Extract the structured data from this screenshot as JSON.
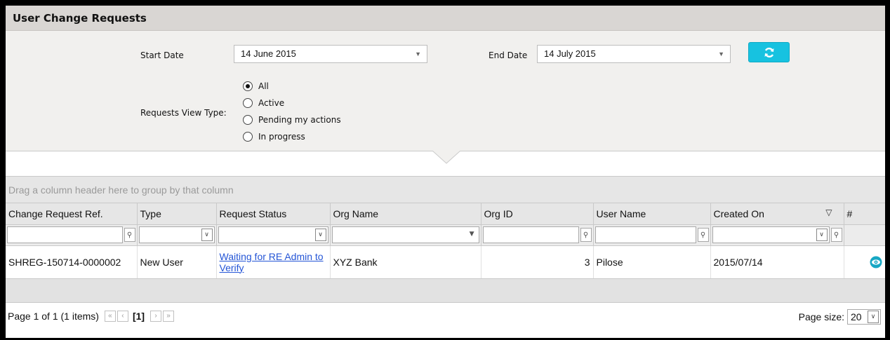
{
  "panel": {
    "title": "User Change Requests"
  },
  "filters": {
    "start_date_label": "Start Date",
    "start_date_value": "14 June 2015",
    "end_date_label": "End Date",
    "end_date_value": "14 July 2015",
    "view_type_label": "Requests View Type:",
    "view_type_options": [
      "All",
      "Active",
      "Pending my actions",
      "In progress"
    ],
    "view_type_selected": "All"
  },
  "grid": {
    "group_hint": "Drag a column header here to group by that column",
    "columns": [
      "Change Request Ref.",
      "Type",
      "Request Status",
      "Org Name",
      "Org ID",
      "User Name",
      "Created On",
      "#"
    ],
    "rows": [
      {
        "ref": "SHREG-150714-0000002",
        "type": "New User",
        "status": "Waiting for RE Admin to Verify",
        "org_name": "XYZ Bank",
        "org_id": "3",
        "user_name": "Pilose",
        "created_on": "2015/07/14"
      }
    ]
  },
  "pager": {
    "summary": "Page 1 of 1 (1 items)",
    "current_page": "[1]",
    "page_size_label": "Page size:",
    "page_size_value": "20"
  },
  "colors": {
    "accent": "#17c2e0",
    "link": "#2455d6",
    "header_bg": "#d9d6d3"
  },
  "icons": [
    "refresh-icon",
    "filter-icon",
    "dropdown-icon",
    "view-eye-icon",
    "first-page-icon",
    "prev-page-icon",
    "next-page-icon",
    "last-page-icon"
  ]
}
